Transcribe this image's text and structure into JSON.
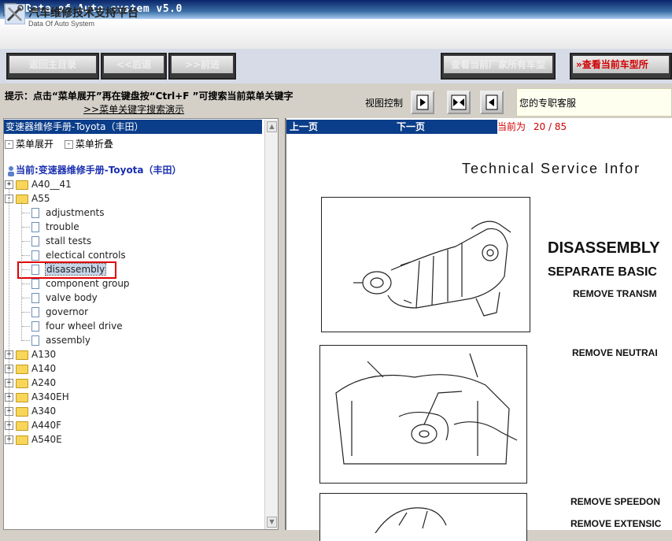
{
  "window": {
    "title": "Data of Auto system v5.0"
  },
  "header": {
    "app_name": "汽车维修技术支持平台",
    "app_subtitle": "Data Of Auto System"
  },
  "toolbar": {
    "home": "返回主目录",
    "back": "<<后退",
    "forward": ">>前进",
    "all_models": "查看当前厂家所有车型",
    "current_model": "查看当前车型所"
  },
  "hint": {
    "text": "提示：点击“菜单展开”再在键盘按“Ctrl+F ”可搜索当前菜单关键字",
    "link": ">>菜单关键字搜索演示",
    "view_control": "视图控制",
    "service": "您的专职客服"
  },
  "tree": {
    "header": "变速器维修手册-Toyota（丰田）",
    "expand": "菜单展开",
    "collapse": "菜单折叠",
    "current": "当前:变速器维修手册-Toyota（丰田）",
    "nodes": [
      {
        "label": "A40__41",
        "type": "folder",
        "expanded": false
      },
      {
        "label": "A55",
        "type": "folder",
        "expanded": true
      },
      {
        "label": "adjustments",
        "type": "doc"
      },
      {
        "label": "trouble",
        "type": "doc"
      },
      {
        "label": "stall tests",
        "type": "doc"
      },
      {
        "label": "electical controls",
        "type": "doc"
      },
      {
        "label": "disassembly",
        "type": "doc",
        "selected": true
      },
      {
        "label": "component group",
        "type": "doc"
      },
      {
        "label": "valve body",
        "type": "doc"
      },
      {
        "label": "governor",
        "type": "doc"
      },
      {
        "label": "four wheel drive",
        "type": "doc"
      },
      {
        "label": "assembly",
        "type": "doc"
      },
      {
        "label": "A130",
        "type": "folder",
        "expanded": false
      },
      {
        "label": "A140",
        "type": "folder",
        "expanded": false
      },
      {
        "label": "A240",
        "type": "folder",
        "expanded": false
      },
      {
        "label": "A340EH",
        "type": "folder",
        "expanded": false
      },
      {
        "label": "A340",
        "type": "folder",
        "expanded": false
      },
      {
        "label": "A440F",
        "type": "folder",
        "expanded": false
      },
      {
        "label": "A540E",
        "type": "folder",
        "expanded": false
      }
    ]
  },
  "viewer": {
    "prev": "上一页",
    "next": "下一页",
    "page_prefix": "当前为",
    "page_current": "20",
    "page_total": "85",
    "doc_title": "Technical Service Infor",
    "heading1": "DISASSEMBLY",
    "heading2": "SEPARATE BASIC",
    "step1": "REMOVE TRANSM",
    "step2": "REMOVE NEUTRAI",
    "step3": "REMOVE SPEEDON",
    "step4": "REMOVE EXTENSIC"
  },
  "colors": {
    "accent_blue": "#0a3d8a",
    "page_red": "#d00000",
    "selection_red": "#e00000"
  }
}
